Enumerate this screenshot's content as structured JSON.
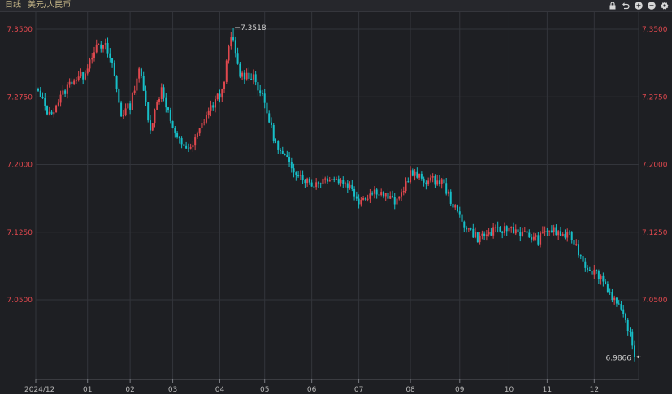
{
  "header": {
    "period": "日线",
    "symbol": "美元/人民币",
    "tools": [
      {
        "icon": "lock-icon"
      },
      {
        "icon": "undo-icon"
      },
      {
        "icon": "zoom-in-icon"
      },
      {
        "icon": "zoom-out-icon"
      },
      {
        "icon": "settings-icon"
      }
    ]
  },
  "colors": {
    "up": "#e0484e",
    "down": "#17bfc8",
    "axis_label": "#e0484e",
    "grid": "#33353b",
    "background": "#1e1f23"
  },
  "chart_data": {
    "type": "candlestick",
    "ylim": [
      6.975,
      7.365
    ],
    "y_ticks": [
      7.05,
      7.125,
      7.2,
      7.275,
      7.35
    ],
    "y_tick_labels": [
      "7.0500",
      "7.1250",
      "7.2000",
      "7.2750",
      "7.3500"
    ],
    "x_ticks": [
      {
        "label": "2024/12",
        "index": 0
      },
      {
        "label": "01",
        "index": 22
      },
      {
        "label": "02",
        "index": 41
      },
      {
        "label": "03",
        "index": 60
      },
      {
        "label": "04",
        "index": 81
      },
      {
        "label": "05",
        "index": 101
      },
      {
        "label": "06",
        "index": 122
      },
      {
        "label": "07",
        "index": 143
      },
      {
        "label": "08",
        "index": 166
      },
      {
        "label": "09",
        "index": 188
      },
      {
        "label": "10",
        "index": 210
      },
      {
        "label": "11",
        "index": 227
      },
      {
        "label": "12",
        "index": 248
      }
    ],
    "price_path": [
      [
        0,
        7.2795
      ],
      [
        5,
        7.2545
      ],
      [
        10,
        7.2745
      ],
      [
        15,
        7.2935
      ],
      [
        20,
        7.2985
      ],
      [
        25,
        7.3285
      ],
      [
        30,
        7.3305
      ],
      [
        33,
        7.3115
      ],
      [
        37,
        7.2555
      ],
      [
        41,
        7.2655
      ],
      [
        45,
        7.3075
      ],
      [
        50,
        7.2405
      ],
      [
        55,
        7.2855
      ],
      [
        61,
        7.2305
      ],
      [
        68,
        7.2155
      ],
      [
        75,
        7.2555
      ],
      [
        82,
        7.2815
      ],
      [
        86,
        7.3415
      ],
      [
        90,
        7.2995
      ],
      [
        96,
        7.2985
      ],
      [
        101,
        7.2675
      ],
      [
        104,
        7.2395
      ],
      [
        107,
        7.2155
      ],
      [
        115,
        7.1925
      ],
      [
        122,
        7.1775
      ],
      [
        130,
        7.1865
      ],
      [
        138,
        7.1785
      ],
      [
        143,
        7.1605
      ],
      [
        151,
        7.1715
      ],
      [
        160,
        7.1575
      ],
      [
        166,
        7.1905
      ],
      [
        172,
        7.1825
      ],
      [
        180,
        7.1815
      ],
      [
        186,
        7.1505
      ],
      [
        190,
        7.1335
      ],
      [
        196,
        7.1185
      ],
      [
        203,
        7.1255
      ],
      [
        211,
        7.1295
      ],
      [
        216,
        7.1235
      ],
      [
        223,
        7.1165
      ],
      [
        227,
        7.1285
      ],
      [
        233,
        7.1225
      ],
      [
        238,
        7.1195
      ],
      [
        244,
        7.0885
      ],
      [
        251,
        7.0755
      ],
      [
        258,
        7.0455
      ],
      [
        263,
        7.0205
      ],
      [
        266,
        6.9866
      ]
    ],
    "annotations": [
      {
        "label": "7.3518",
        "type": "max",
        "index": 87,
        "value": 7.3518
      },
      {
        "label": "6.9866",
        "type": "last",
        "index": 266,
        "value": 6.9866
      }
    ]
  }
}
